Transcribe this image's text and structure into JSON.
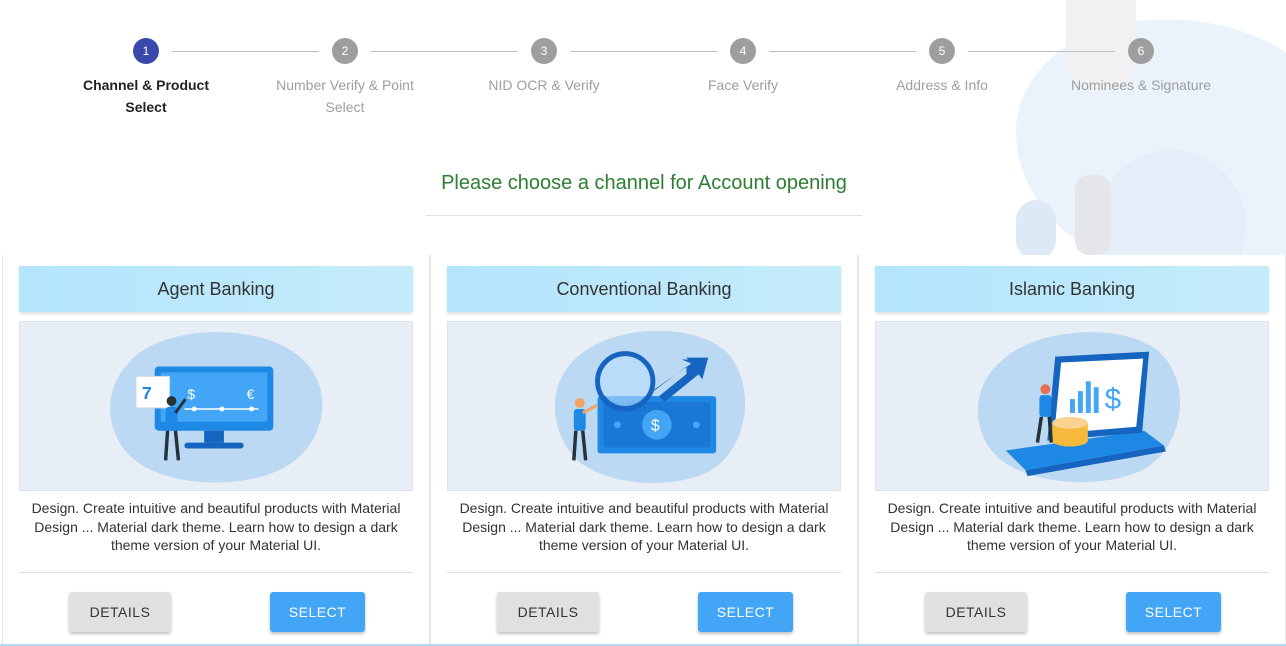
{
  "stepper": {
    "steps": [
      {
        "number": "1",
        "label": "Channel & Product Select",
        "active": true
      },
      {
        "number": "2",
        "label": "Number Verify & Point Select",
        "active": false
      },
      {
        "number": "3",
        "label": "NID OCR & Verify",
        "active": false
      },
      {
        "number": "4",
        "label": "Face Verify",
        "active": false
      },
      {
        "number": "5",
        "label": "Address & Info",
        "active": false
      },
      {
        "number": "6",
        "label": "Nominees & Signature",
        "active": false
      }
    ]
  },
  "heading": "Please choose a channel for Account opening",
  "cards": [
    {
      "title": "Agent Banking",
      "illustration": "agent-banking-illustration",
      "description": "Design. Create intuitive and beautiful products with Material Design ... Material dark theme. Learn how to design a dark theme version of your Material UI.",
      "details_label": "DETAILS",
      "select_label": "SELECT"
    },
    {
      "title": "Conventional Banking",
      "illustration": "conventional-banking-illustration",
      "description": "Design. Create intuitive and beautiful products with Material Design ... Material dark theme. Learn how to design a dark theme version of your Material UI.",
      "details_label": "DETAILS",
      "select_label": "SELECT"
    },
    {
      "title": "Islamic Banking",
      "illustration": "islamic-banking-illustration",
      "description": "Design. Create intuitive and beautiful products with Material Design ... Material dark theme. Learn how to design a dark theme version of your Material UI.",
      "details_label": "DETAILS",
      "select_label": "SELECT"
    }
  ],
  "colors": {
    "active_step": "#3949ab",
    "inactive_step": "#9e9e9e",
    "heading": "#2e7d32",
    "card_title_bg": "#b3e5fc",
    "select_button": "#42a5f5",
    "details_button": "#e0e0e0"
  }
}
